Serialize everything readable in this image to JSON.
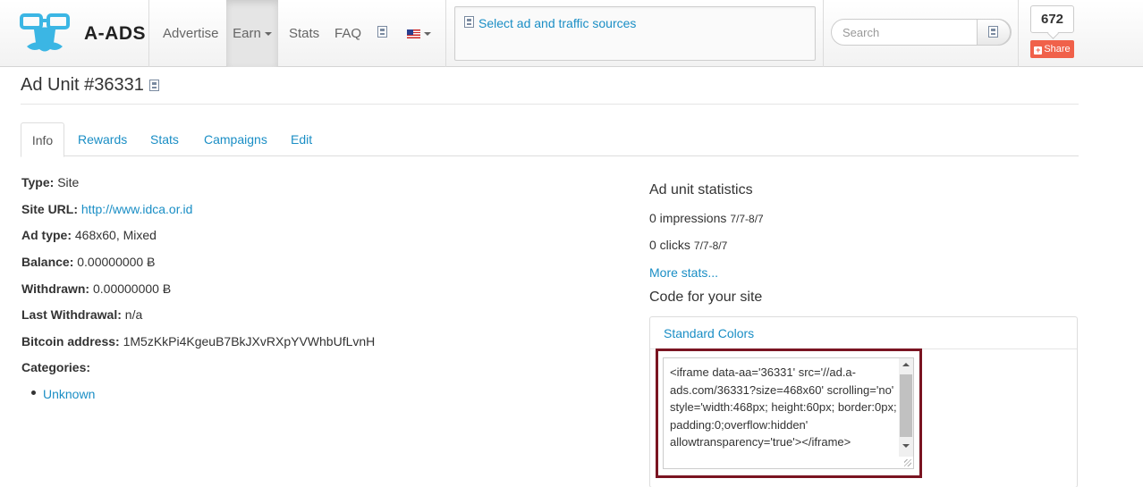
{
  "brand": {
    "name": "A-ADS"
  },
  "nav": {
    "advertise": "Advertise",
    "earn": "Earn",
    "stats": "Stats",
    "faq": "FAQ",
    "language_flag": "us-flag-icon"
  },
  "select_sources": {
    "label": "Select ad and traffic sources"
  },
  "search": {
    "placeholder": "Search"
  },
  "share": {
    "count": "672",
    "label": "Share"
  },
  "page": {
    "title": "Ad Unit #36331"
  },
  "tabs": [
    {
      "label": "Info",
      "active": true
    },
    {
      "label": "Rewards"
    },
    {
      "label": "Stats"
    },
    {
      "label": "Campaigns"
    },
    {
      "label": "Edit"
    }
  ],
  "info": {
    "type": {
      "label": "Type:",
      "value": "Site"
    },
    "site_url": {
      "label": "Site URL:",
      "value": "http://www.idca.or.id"
    },
    "ad_type": {
      "label": "Ad type:",
      "value": "468x60, Mixed"
    },
    "balance": {
      "label": "Balance:",
      "value": "0.00000000 Ƀ"
    },
    "withdrawn": {
      "label": "Withdrawn:",
      "value": "0.00000000 Ƀ"
    },
    "last_withdrawal": {
      "label": "Last Withdrawal:",
      "value": "n/a"
    },
    "bitcoin_address": {
      "label": "Bitcoin address:",
      "value": "1M5zKkPi4KgeuB7BkJXvRXpYVWhbUfLvnH"
    },
    "categories": {
      "label": "Categories:",
      "items": [
        "Unknown"
      ]
    }
  },
  "stats": {
    "title": "Ad unit statistics",
    "impressions": {
      "text": "0 impressions",
      "range": "7/7-8/7"
    },
    "clicks": {
      "text": "0 clicks",
      "range": "7/7-8/7"
    },
    "more": "More stats..."
  },
  "code": {
    "title": "Code for your site",
    "tab_label": "Standard Colors",
    "snippet": "<iframe data-aa='36331' src='//ad.a-ads.com/36331?size=468x60' scrolling='no' style='width:468px; height:60px; border:0px; padding:0;overflow:hidden' allowtransparency='true'></iframe>"
  },
  "colors": {
    "link": "#1a8ec5",
    "share": "#f0614a",
    "highlight_border": "#7a1421"
  }
}
